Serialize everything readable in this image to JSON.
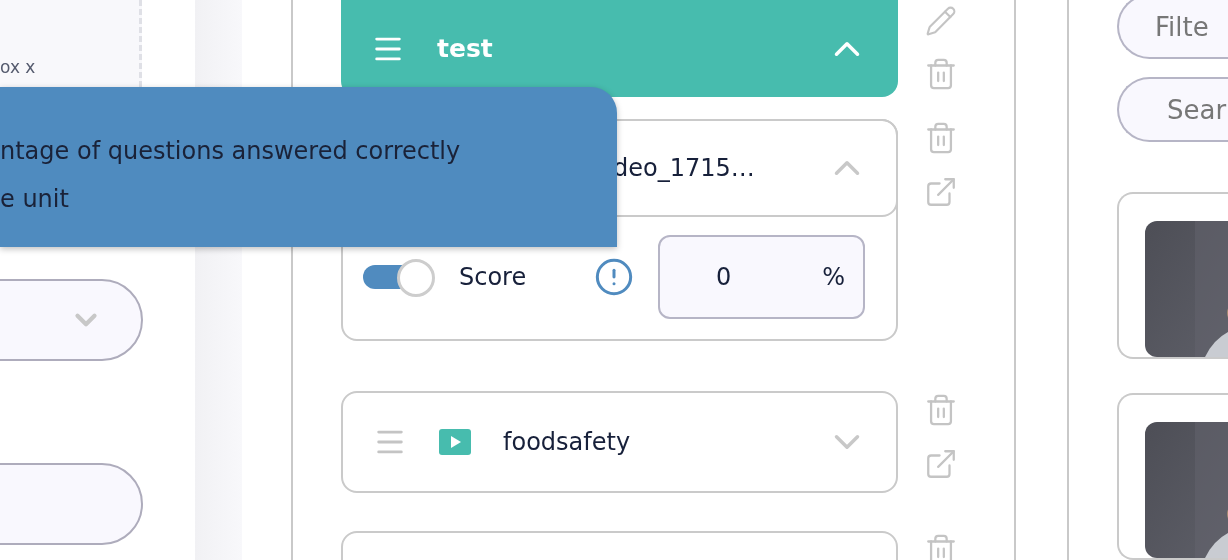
{
  "sidebar": {
    "caption": "ox x",
    "fields": [
      {
        "kind": "select"
      },
      {
        "kind": "input"
      }
    ]
  },
  "tooltip": {
    "lines": [
      "ntage of questions answered correctly",
      "e unit"
    ]
  },
  "rows": [
    {
      "kind": "section",
      "title": "test",
      "expanded": true
    },
    {
      "kind": "item",
      "title": "deo_1715…",
      "expanded": true,
      "score": {
        "label": "Score",
        "on": true,
        "value": "0",
        "unit": "%"
      }
    },
    {
      "kind": "item",
      "title": "foodsafety",
      "expanded": false
    },
    {
      "kind": "stub"
    }
  ],
  "library": {
    "fields": [
      {
        "placeholder": "Filte"
      },
      {
        "placeholder": "Sear"
      }
    ]
  }
}
